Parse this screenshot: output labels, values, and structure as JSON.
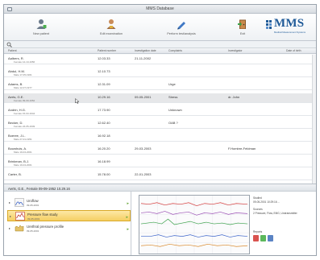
{
  "window": {
    "title": "MMS Database"
  },
  "toolbar": {
    "buttons": [
      {
        "label": "New patient",
        "icon": "user-add-icon"
      },
      {
        "label": "Edit examination",
        "icon": "user-edit-icon"
      },
      {
        "label": "Perform test/analysis",
        "icon": "pen-icon"
      },
      {
        "label": "Exit",
        "icon": "exit-door-icon"
      }
    ]
  },
  "logo": {
    "text": "MMS",
    "subtitle": "Medical Measurement Systems"
  },
  "table": {
    "columns": [
      "Patient",
      "Patient number",
      "Investigation date",
      "Complaints",
      "Investigator",
      "Date of birth"
    ],
    "rows": [
      {
        "name": "Aalbers, R.",
        "sub": "Female 12-10-1956",
        "number": "12.03.33",
        "date": "21-11-2002",
        "complaint": "",
        "investigator": ""
      },
      {
        "name": "Abdul, H.M.",
        "sub": "Male 17-05-1961",
        "number": "12.10.73",
        "date": "",
        "complaint": "",
        "investigator": ""
      },
      {
        "name": "Adams, B.",
        "sub": "Male 12-07-1977",
        "number": "12.31.09",
        "date": "",
        "complaint": "Urge",
        "investigator": ""
      },
      {
        "name": "Aerts, G.E.",
        "sub": "Female 09-09-1952",
        "number": "10.29.16",
        "date": "09-05-2001",
        "complaint": "Stress",
        "investigator": "dr. John"
      },
      {
        "name": "Andrin, H.G.",
        "sub": "Female 15-03-1944",
        "number": "17.73.90",
        "date": "",
        "complaint": "Unknown",
        "investigator": ""
      },
      {
        "name": "Becker, D.",
        "sub": "Female 24-05-1949",
        "number": "12.62.40",
        "date": "",
        "complaint": "OAB ?",
        "investigator": ""
      },
      {
        "name": "Boeree, J.L.",
        "sub": "Male 27-01-1951",
        "number": "16.92.18",
        "date": "",
        "complaint": "",
        "investigator": ""
      },
      {
        "name": "Bouwhuis, A.",
        "sub": "Male 19-04-2001",
        "number": "16.20.20",
        "date": "29-03-2003",
        "complaint": "",
        "investigator": "F.Hombre-Feldman"
      },
      {
        "name": "Brinkman, B.J.",
        "sub": "Male 19-04-2001",
        "number": "16.18.99",
        "date": "",
        "complaint": "",
        "investigator": ""
      },
      {
        "name": "Carter, B.",
        "sub": "",
        "number": "15.78.00",
        "date": "22-01-2003",
        "complaint": "",
        "investigator": ""
      }
    ],
    "selected_index": 3
  },
  "selection_bar": {
    "text": "Aerts, G.E., Female 09-09-1952 10.29.16"
  },
  "investigations": [
    {
      "title": "Uroflow",
      "date": "09-05-2001",
      "icon": "uroflow-icon",
      "active": false
    },
    {
      "title": "Pressure flow study",
      "date": "09-05-2001",
      "icon": "pressure-flow-icon",
      "active": true
    },
    {
      "title": "Urethral pressure profile",
      "date": "09-05-2001",
      "icon": "pressure-profile-icon",
      "active": false
    }
  ],
  "details": {
    "line1": "Studied",
    "line2": "09-05-2001 10:29:16 ...",
    "line3": "Sources",
    "line4": "2 Pressure, Flow, EMG, Urotransmitter",
    "reports_label": "Reports"
  },
  "colors": {
    "accent": "#1f5a98",
    "selected_row": "#e6e7e9",
    "active_item": "#f5cf63",
    "trace_red": "#d53b3b",
    "trace_green": "#3aa14a",
    "trace_blue": "#3b63c9",
    "trace_purple": "#9a4fb4"
  }
}
